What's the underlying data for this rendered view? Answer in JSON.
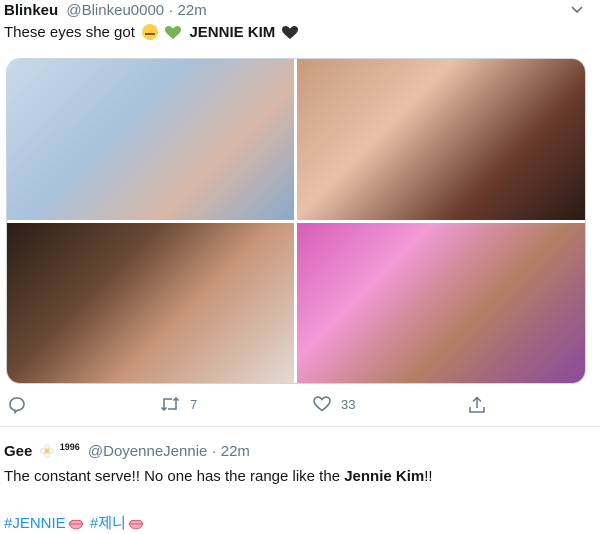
{
  "tweet1": {
    "name": "Blinkeu",
    "handle": "@Blinkeu0000",
    "separator": "·",
    "time": "22m",
    "text_prefix": "These eyes she got",
    "text_bold": "JENNIE KIM",
    "emojis": [
      "grimacing-face-icon",
      "green-heart-icon",
      "black-heart-icon"
    ],
    "images": [
      "photo-1",
      "photo-2",
      "photo-3",
      "photo-4"
    ],
    "actions": {
      "reply_count": "",
      "retweet_count": "7",
      "like_count": "33"
    }
  },
  "tweet2": {
    "name": "Gee",
    "superscript": "1996",
    "handle": "@DoyenneJennie",
    "separator": "·",
    "time": "22m",
    "text_prefix": "The constant serve!! No one has the range like the ",
    "text_bold": "Jennie Kim",
    "text_suffix": "!!",
    "hashtag1": "#JENNIE",
    "hashtag2": "#제니"
  },
  "colors": {
    "link": "#1b95e0",
    "muted": "#657786",
    "text": "#14171a",
    "border": "#ccd6dd"
  }
}
